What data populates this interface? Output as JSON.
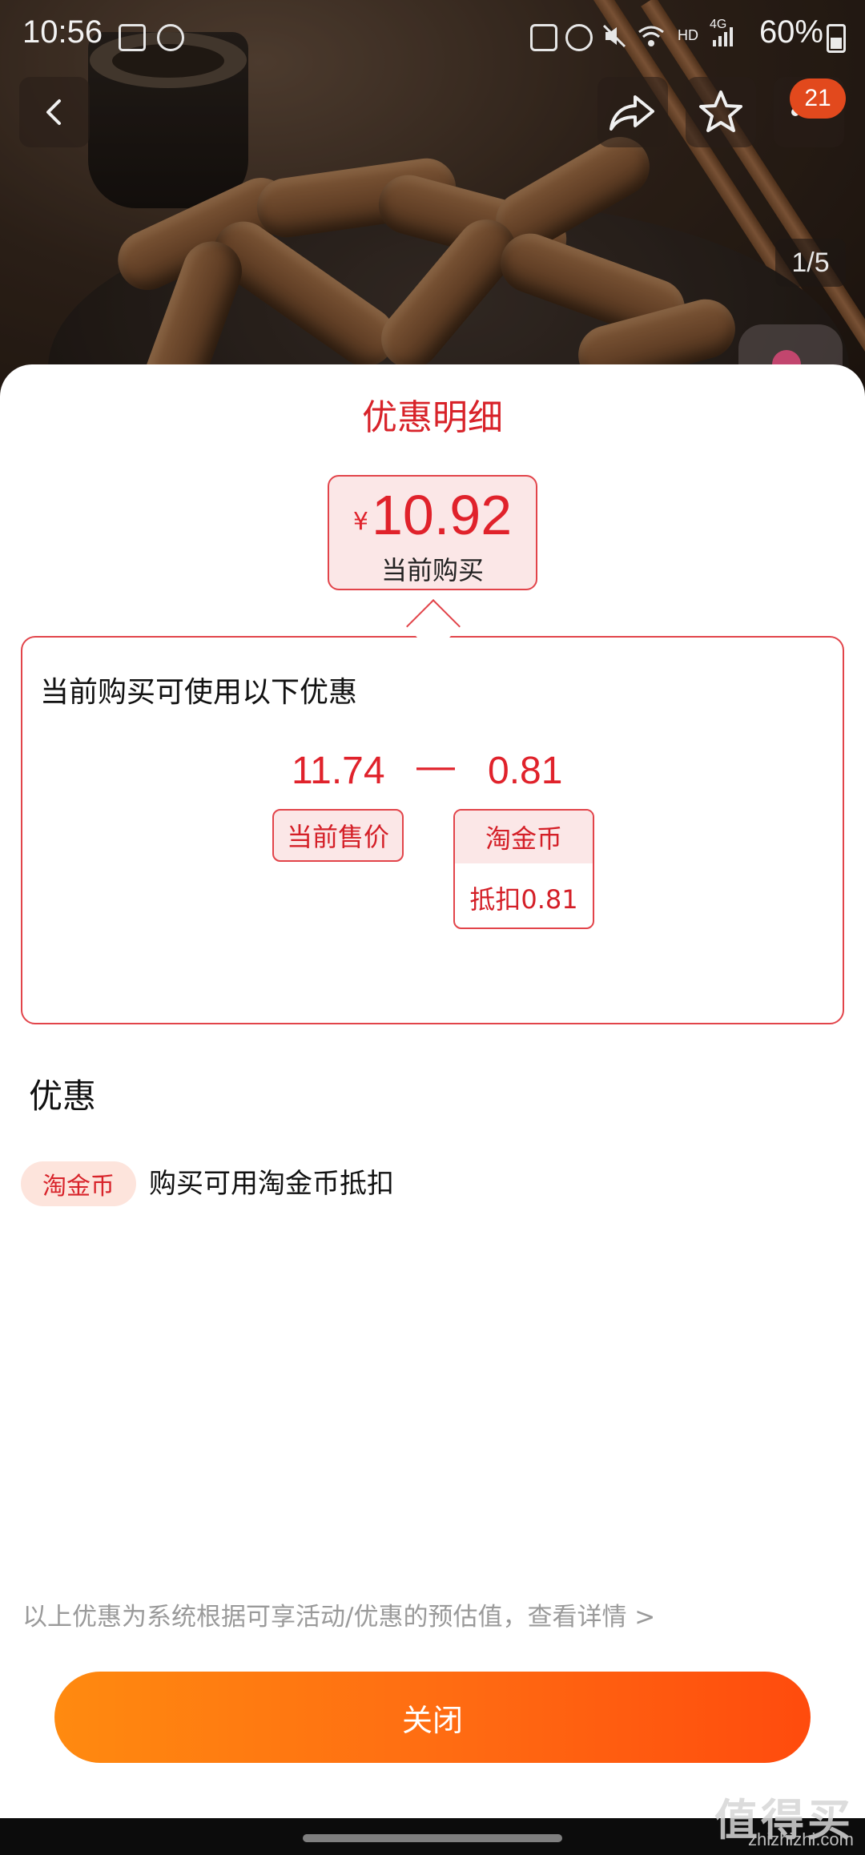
{
  "status_bar": {
    "time": "10:56",
    "battery": "60%",
    "network": "4G",
    "hd": "HD"
  },
  "product_header": {
    "cart_badge": "21",
    "image_index": "1/5",
    "icons": [
      "back-arrow-icon",
      "share-icon",
      "star-icon",
      "more-icon",
      "live-icon"
    ]
  },
  "sheet": {
    "title": "优惠明细",
    "price": {
      "currency": "¥",
      "value": "10.92",
      "caption": "当前购买"
    },
    "detail": {
      "heading": "当前购买可使用以下优惠",
      "price": "11.74",
      "operator": "—",
      "discount": "0.81",
      "price_tag": "当前售价",
      "coin_tag": "淘金币",
      "coin_sub": "抵扣0.81"
    },
    "promotions": {
      "heading": "优惠",
      "items": [
        {
          "badge": "淘金币",
          "text": "购买可用淘金币抵扣"
        }
      ]
    },
    "footer_note": "以上优惠为系统根据可享活动/优惠的预估值，查看详情 >",
    "close_label": "关闭"
  },
  "watermark": {
    "text": "值得买",
    "url": "zhizhizhi.com"
  },
  "colors": {
    "accent_red": "#e0222b",
    "button_orange": "#ff6a12"
  }
}
